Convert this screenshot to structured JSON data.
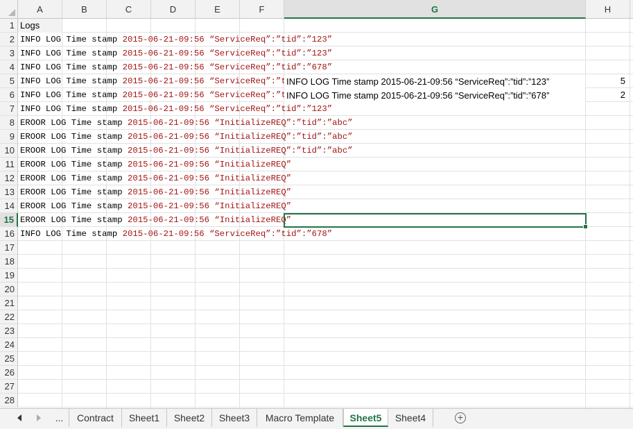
{
  "columns": [
    "A",
    "B",
    "C",
    "D",
    "E",
    "F",
    "G",
    "H"
  ],
  "selected_column": "G",
  "selected_row": "15",
  "rows": [
    "1",
    "2",
    "3",
    "4",
    "5",
    "6",
    "7",
    "8",
    "9",
    "10",
    "11",
    "12",
    "13",
    "14",
    "15",
    "16",
    "17",
    "18",
    "19",
    "20",
    "21",
    "22",
    "23",
    "24",
    "25",
    "26",
    "27",
    "28"
  ],
  "cells": {
    "a1": "Logs",
    "a2": {
      "prefix": "INFO LOG Time stamp ",
      "stamp": "2015-06-21-09:56",
      "body": " “ServiceReq”:”tid”:”123”"
    },
    "a3": {
      "prefix": "INFO LOG Time stamp ",
      "stamp": "2015-06-21-09:56",
      "body": " “ServiceReq”:”tid”:”123”"
    },
    "a4": {
      "prefix": "INFO LOG Time stamp ",
      "stamp": "2015-06-21-09:56",
      "body": " “ServiceReq”:”tid”:”678”"
    },
    "a5": {
      "prefix": "INFO LOG Time stamp ",
      "stamp": "2015-06-21-09:56",
      "body": " “ServiceReq”:”tid”"
    },
    "a6": {
      "prefix": "INFO LOG Time stamp ",
      "stamp": "2015-06-21-09:56",
      "body": " “ServiceReq”:”tid”"
    },
    "a7": {
      "prefix": "INFO LOG Time stamp ",
      "stamp": "2015-06-21-09:56",
      "body": " “ServiceReq”:”tid”:”123”"
    },
    "a8": {
      "prefix": "EROOR LOG Time stamp ",
      "stamp": "2015-06-21-09:56",
      "body": " “InitializeREQ”:”tid”:”abc”"
    },
    "a9": {
      "prefix": "EROOR LOG Time stamp ",
      "stamp": "2015-06-21-09:56",
      "body": " “InitializeREQ”:”tid”:”abc”"
    },
    "a10": {
      "prefix": "EROOR LOG Time stamp ",
      "stamp": "2015-06-21-09:56",
      "body": " “InitializeREQ”:”tid”:”abc”"
    },
    "a11": {
      "prefix": "EROOR LOG Time stamp ",
      "stamp": "2015-06-21-09:56",
      "body": " “InitializeREQ”"
    },
    "a12": {
      "prefix": "EROOR LOG Time stamp ",
      "stamp": "2015-06-21-09:56",
      "body": " “InitializeREQ”"
    },
    "a13": {
      "prefix": "EROOR LOG Time stamp ",
      "stamp": "2015-06-21-09:56",
      "body": " “InitializeREQ”"
    },
    "a14": {
      "prefix": "EROOR LOG Time stamp ",
      "stamp": "2015-06-21-09:56",
      "body": " “InitializeREQ”"
    },
    "a15": {
      "prefix": "EROOR LOG Time stamp ",
      "stamp": "2015-06-21-09:56",
      "body": " “InitializeREQ”"
    },
    "a16": {
      "prefix": "INFO LOG Time stamp ",
      "stamp": "2015-06-21-09:56",
      "body": " “ServiceReq”:”tid”:”678”"
    },
    "g5": "INFO LOG Time stamp 2015-06-21-09:56 “ServiceReq”:”tid”:”123”",
    "g6": "INFO LOG Time stamp 2015-06-21-09:56 “ServiceReq”:”tid”:”678”",
    "h5": "5",
    "h6": "2"
  },
  "tabs": {
    "ellipsis": "...",
    "list": [
      "Contract",
      "Sheet1",
      "Sheet2",
      "Sheet3",
      "Macro Template",
      "Sheet5",
      "Sheet4"
    ],
    "active": "Sheet5",
    "add_icon": "plus-circle-icon",
    "prev_icon": "triangle-left-icon",
    "next_icon": "triangle-right-icon"
  },
  "colors": {
    "accent": "#217346",
    "timestamp_red": "#a31515"
  }
}
